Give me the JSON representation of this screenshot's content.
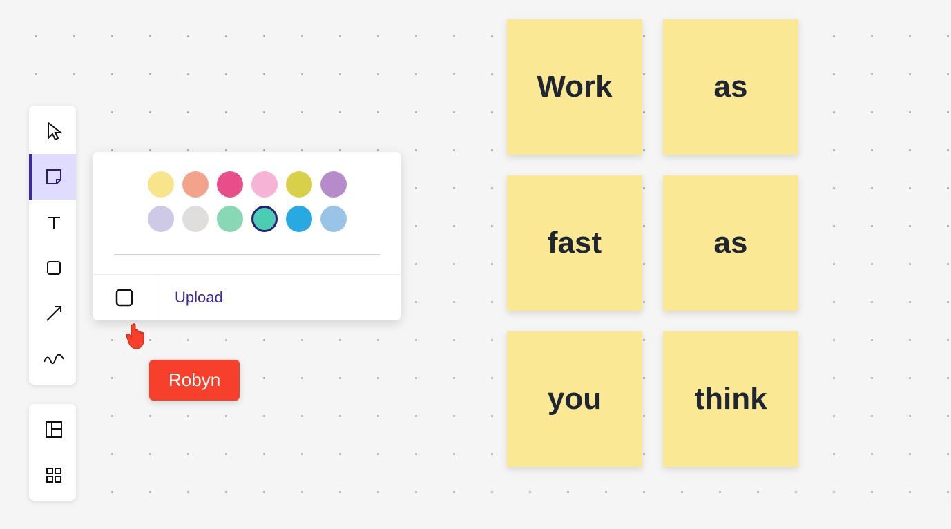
{
  "toolbar": {
    "tools": [
      {
        "name": "select",
        "active": false
      },
      {
        "name": "sticky-note",
        "active": true
      },
      {
        "name": "text",
        "active": false
      },
      {
        "name": "shape",
        "active": false
      },
      {
        "name": "arrow",
        "active": false
      },
      {
        "name": "scribble",
        "active": false
      }
    ],
    "secondary": [
      {
        "name": "template"
      },
      {
        "name": "grid-apps"
      }
    ]
  },
  "colorPicker": {
    "rows": [
      [
        "#f8e58b",
        "#f4a38b",
        "#e84e8a",
        "#f6b3d6",
        "#d9d04a",
        "#b58cc9"
      ],
      [
        "#cfc9e8",
        "#e0dedd",
        "#88d8b5",
        "#4acdb2",
        "#28a9e1",
        "#9ac3e8"
      ]
    ],
    "selectedIndex": [
      1,
      3
    ],
    "uploadLabel": "Upload"
  },
  "presence": {
    "userName": "Robyn",
    "color": "#f6402c"
  },
  "stickies": [
    {
      "text": "Work"
    },
    {
      "text": "as"
    },
    {
      "text": "fast"
    },
    {
      "text": "as"
    },
    {
      "text": "you"
    },
    {
      "text": "think"
    }
  ]
}
